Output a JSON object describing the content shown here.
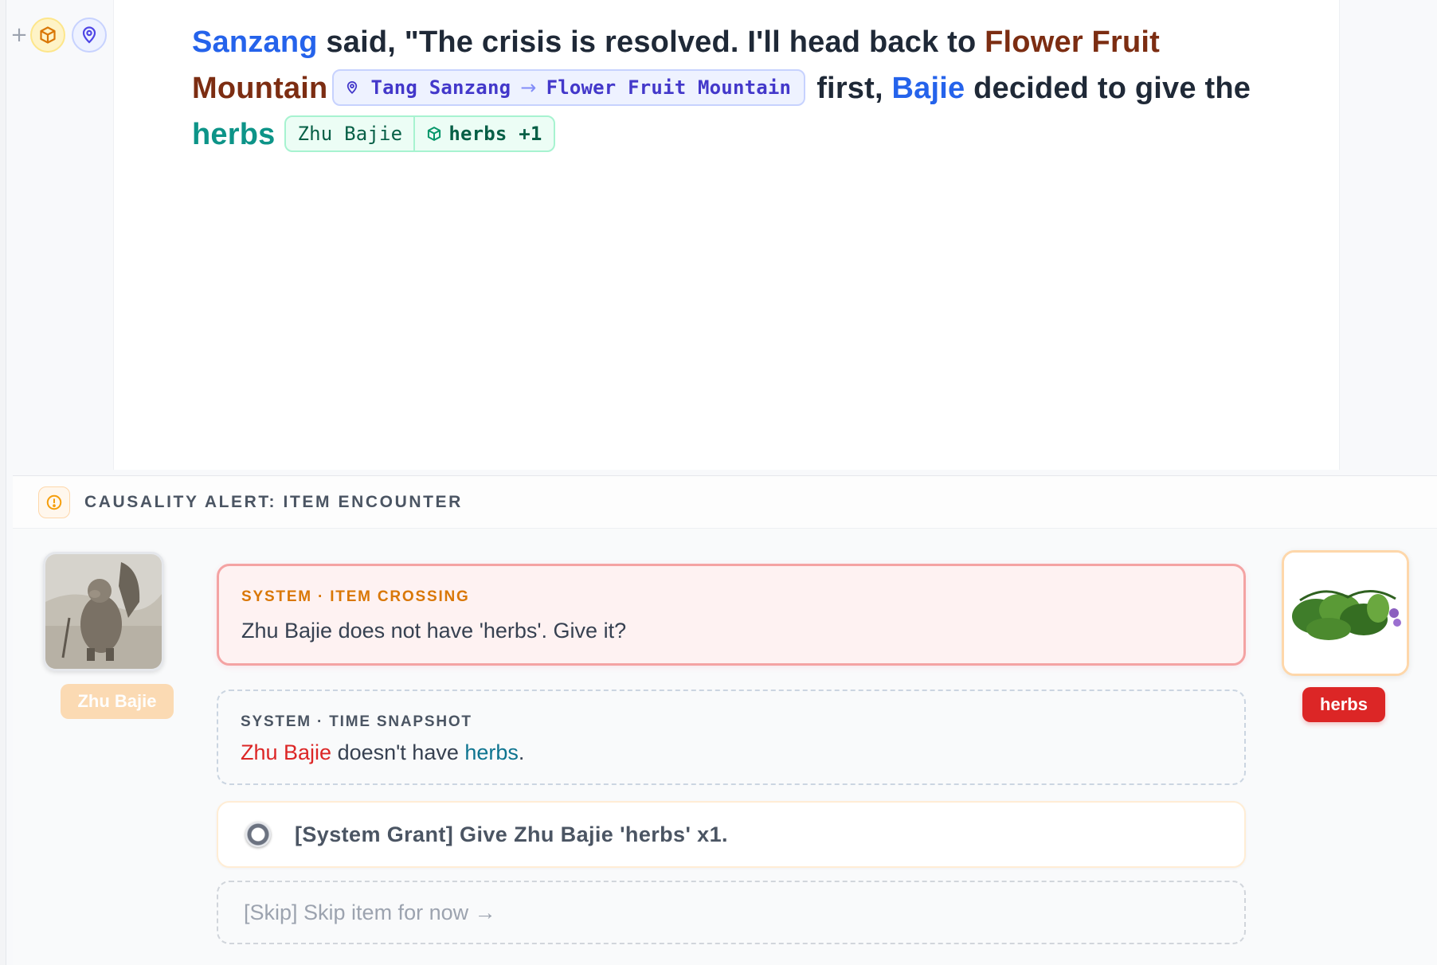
{
  "editor": {
    "story": {
      "char1": "Sanzang",
      "text1": " said, \"The crisis is resolved. I'll head back to ",
      "loc1": "Flower Fruit Mountain",
      "move_chip": {
        "from": "Tang Sanzang",
        "arrow": "→",
        "to": "Flower Fruit Mountain"
      },
      "text2": "first, ",
      "char2": "Bajie",
      "text3": " decided to give the ",
      "item1": "herbs",
      "give_chip": {
        "character": "Zhu Bajie",
        "item": "herbs +1"
      }
    }
  },
  "alert": {
    "title": "CAUSALITY ALERT: ITEM ENCOUNTER",
    "character": {
      "label": "Zhu Bajie"
    },
    "item": {
      "label": "herbs"
    },
    "crossing": {
      "kicker": "SYSTEM · ITEM CROSSING",
      "message": "Zhu Bajie does not have 'herbs'. Give it?"
    },
    "snapshot": {
      "kicker": "SYSTEM · TIME SNAPSHOT",
      "character": "Zhu Bajie",
      "text": " doesn't have ",
      "item": "herbs",
      "end": "."
    },
    "options": {
      "grant": "[System Grant] Give Zhu Bajie 'herbs' x1.",
      "skip": "[Skip] Skip item for now →"
    }
  },
  "icons": [
    "plus-icon",
    "cube-icon",
    "map-pin-icon",
    "alert-circle-icon"
  ],
  "colors": {
    "character": "#2563eb",
    "location": "#7c2d12",
    "item": "#0d9488",
    "alert_accent": "#d97706",
    "danger": "#dc2626"
  }
}
